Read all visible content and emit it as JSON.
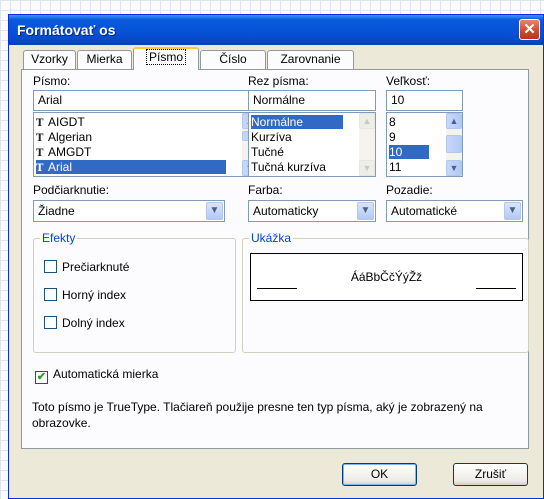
{
  "window": {
    "title": "Formátovať os",
    "close_label": "✕"
  },
  "tabs": [
    {
      "label": "Vzorky",
      "active": false
    },
    {
      "label": "Mierka",
      "active": false
    },
    {
      "label": "Písmo",
      "active": true
    },
    {
      "label": "Číslo",
      "active": false
    },
    {
      "label": "Zarovnanie",
      "active": false
    }
  ],
  "font": {
    "label": "Písmo:",
    "value": "Arial",
    "list": [
      "AIGDT",
      "Algerian",
      "AMGDT",
      "Arial"
    ],
    "selected": "Arial",
    "icon": "truetype-icon"
  },
  "style": {
    "label": "Rez písma:",
    "value": "Normálne",
    "list": [
      "Normálne",
      "Kurzíva",
      "Tučné",
      "Tučná kurzíva"
    ],
    "selected": "Normálne"
  },
  "size": {
    "label": "Veľkosť:",
    "value": "10",
    "list": [
      "8",
      "9",
      "10",
      "11"
    ],
    "selected": "10"
  },
  "underline": {
    "label": "Podčiarknutie:",
    "value": "Žiadne"
  },
  "color": {
    "label": "Farba:",
    "value": "Automaticky"
  },
  "background": {
    "label": "Pozadie:",
    "value": "Automatické"
  },
  "effects": {
    "label": "Efekty",
    "items": [
      {
        "label": "Prečiarknuté",
        "checked": false
      },
      {
        "label": "Horný index",
        "checked": false
      },
      {
        "label": "Dolný index",
        "checked": false
      }
    ]
  },
  "preview": {
    "label": "Ukážka",
    "text": "ÁáBbČčÝýŽž"
  },
  "auto_scale": {
    "label": "Automatická mierka",
    "checked": true
  },
  "info_text": "Toto písmo je TrueType. Tlačiareň použije presne ten typ písma, aký je zobrazený na obrazovke.",
  "buttons": {
    "ok": "OK",
    "cancel": "Zrušiť"
  },
  "colors": {
    "title_bar": "#0552d7",
    "selection": "#316ac5",
    "group_label": "#0046d5",
    "dialog_bg": "#ece9d8"
  }
}
